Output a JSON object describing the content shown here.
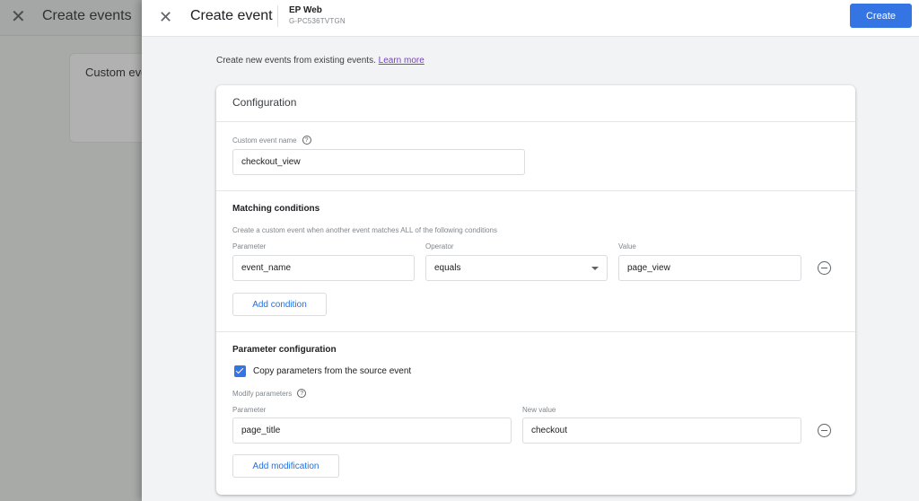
{
  "background": {
    "header_title": "Create events",
    "card_text": "Custom events"
  },
  "drawer": {
    "title": "Create event",
    "property_name": "EP Web",
    "property_id": "G-PC536TVTGN",
    "create_label": "Create",
    "intro_text": "Create new events from existing events.",
    "learn_more": "Learn more"
  },
  "configuration": {
    "title": "Configuration",
    "custom_event_name_label": "Custom event name",
    "custom_event_name_value": "checkout_view",
    "matching": {
      "title": "Matching conditions",
      "description": "Create a custom event when another event matches ALL of the following conditions",
      "headers": {
        "parameter": "Parameter",
        "operator": "Operator",
        "value": "Value"
      },
      "rows": [
        {
          "parameter": "event_name",
          "operator": "equals",
          "value": "page_view"
        }
      ],
      "add_label": "Add condition"
    },
    "parameters": {
      "title": "Parameter configuration",
      "copy_label": "Copy parameters from the source event",
      "copy_checked": true,
      "modify_label": "Modify parameters",
      "headers": {
        "parameter": "Parameter",
        "new_value": "New value"
      },
      "rows": [
        {
          "parameter": "page_title",
          "new_value": "checkout"
        }
      ],
      "add_label": "Add modification"
    }
  },
  "colors": {
    "primary": "#3574e3",
    "link_visited": "#7b3fc4"
  }
}
